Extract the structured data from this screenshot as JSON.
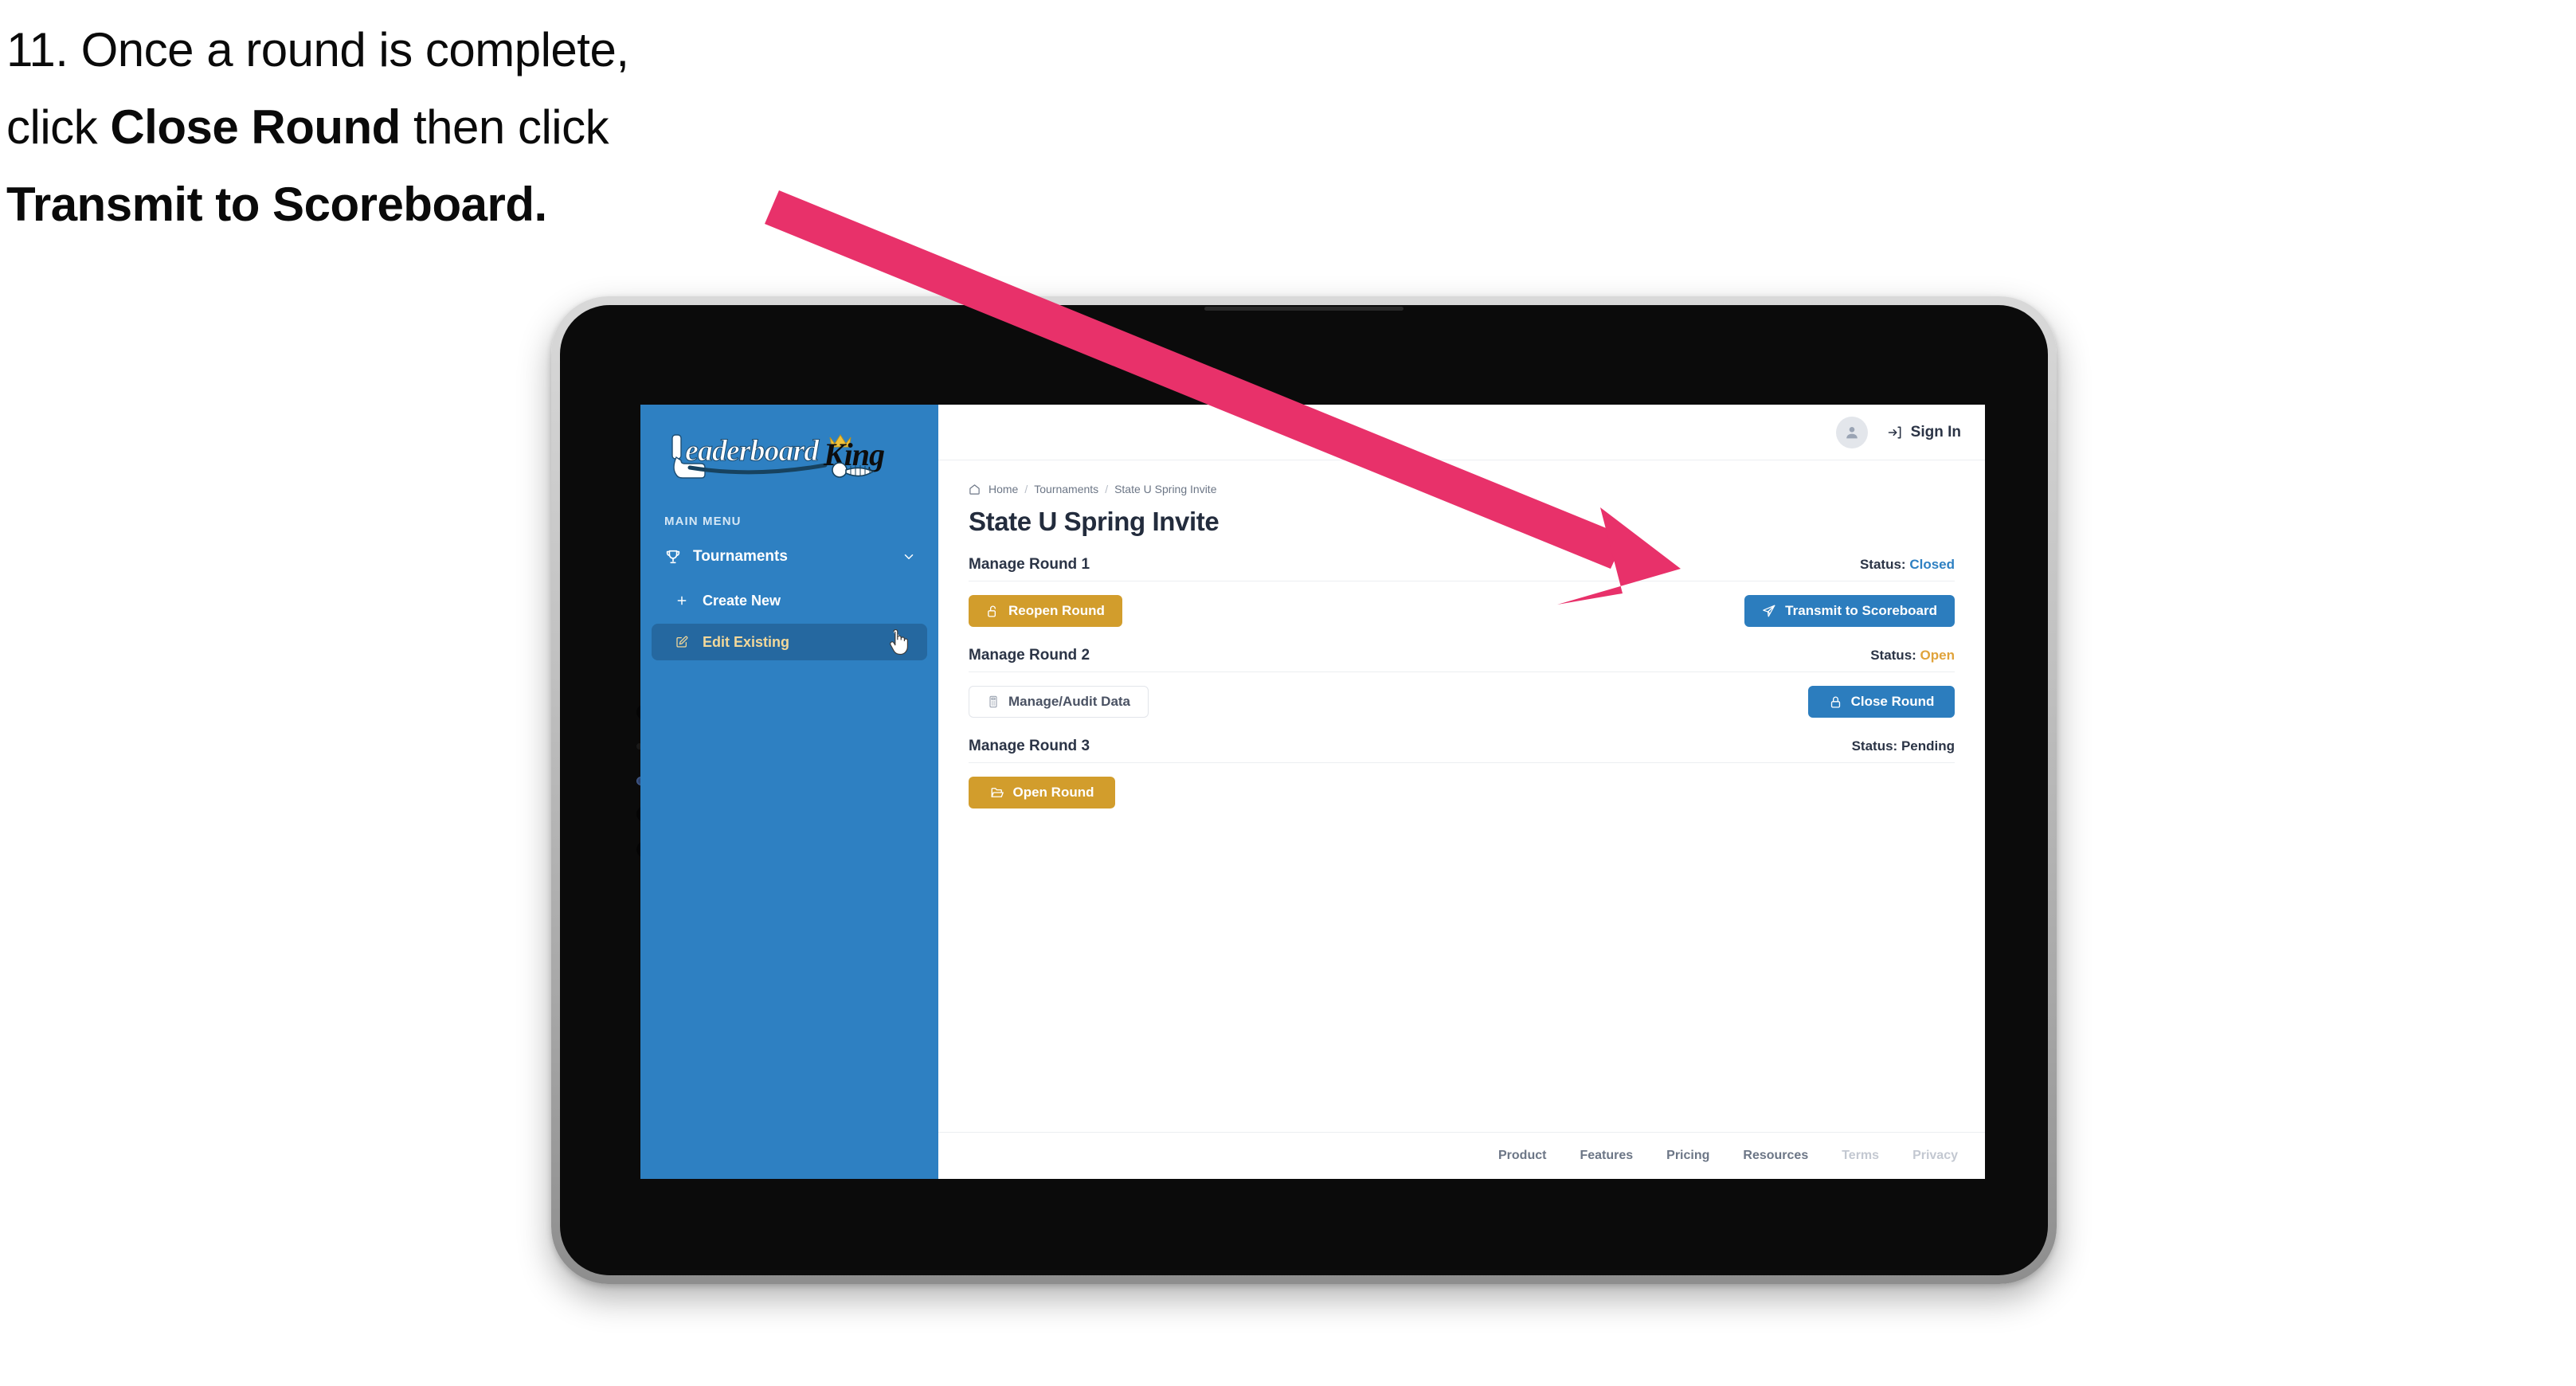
{
  "caption": {
    "line1_plain": "11. Once a round is complete,",
    "line2_plain_a": "click ",
    "line2_bold": "Close Round",
    "line2_plain_b": " then click",
    "line3_bold": "Transmit to Scoreboard."
  },
  "app": {
    "sidebar": {
      "logo_text": "LeaderboardKing",
      "section_label": "MAIN MENU",
      "nav": {
        "label": "Tournaments",
        "icon": "trophy-icon",
        "chevron": "chevron-down-icon"
      },
      "sub_items": [
        {
          "label": "Create New",
          "icon": "plus-icon",
          "active": false
        },
        {
          "label": "Edit Existing",
          "icon": "edit-pencil-icon",
          "active": true
        }
      ]
    },
    "topbar": {
      "avatar_icon": "user-avatar-icon",
      "signin_label": "Sign In",
      "signin_icon": "sign-in-arrow-icon"
    },
    "breadcrumb": {
      "home_icon": "home-icon",
      "items": [
        "Home",
        "Tournaments",
        "State U Spring Invite"
      ],
      "separator": "/"
    },
    "page_title": "State U Spring Invite",
    "rounds": [
      {
        "title": "Manage Round 1",
        "status_label": "Status:",
        "status_value": "Closed",
        "status_kind": "closed",
        "left_button": {
          "label": "Reopen Round",
          "icon": "unlock-icon",
          "style": "gold"
        },
        "right_button": {
          "label": "Transmit to Scoreboard",
          "icon": "paper-plane-icon",
          "style": "blue"
        }
      },
      {
        "title": "Manage Round 2",
        "status_label": "Status:",
        "status_value": "Open",
        "status_kind": "open",
        "left_button": {
          "label": "Manage/Audit Data",
          "icon": "calculator-icon",
          "style": "ghost"
        },
        "right_button": {
          "label": "Close Round",
          "icon": "lock-icon",
          "style": "blue"
        }
      },
      {
        "title": "Manage Round 3",
        "status_label": "Status:",
        "status_value": "Pending",
        "status_kind": "plain",
        "left_button": {
          "label": "Open Round",
          "icon": "folder-open-icon",
          "style": "gold"
        },
        "right_button": null
      }
    ],
    "footer_links": [
      {
        "label": "Product",
        "muted": false
      },
      {
        "label": "Features",
        "muted": false
      },
      {
        "label": "Pricing",
        "muted": false
      },
      {
        "label": "Resources",
        "muted": false
      },
      {
        "label": "Terms",
        "muted": true
      },
      {
        "label": "Privacy",
        "muted": true
      }
    ]
  },
  "colors": {
    "sidebar_blue": "#2e80c2",
    "sidebar_active": "#2568a0",
    "sidebar_active_text": "#f2d89a",
    "button_blue": "#2c7dbe",
    "button_gold": "#d29d2c",
    "status_closed": "#2e80c2",
    "status_open": "#e0a33b",
    "annotation_pink": "#e8316a",
    "text_dark": "#2b3446",
    "text_muted": "#6c7686"
  }
}
